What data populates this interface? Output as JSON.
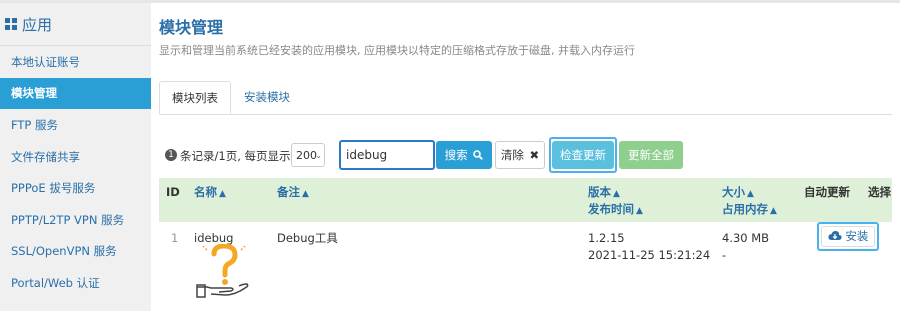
{
  "sidebar": {
    "header": "应用",
    "items": [
      {
        "label": "本地认证账号",
        "active": false
      },
      {
        "label": "模块管理",
        "active": true
      },
      {
        "label": "FTP 服务",
        "active": false
      },
      {
        "label": "文件存储共享",
        "active": false
      },
      {
        "label": "PPPoE 拔号服务",
        "active": false
      },
      {
        "label": "PPTP/L2TP VPN 服务",
        "active": false
      },
      {
        "label": "SSL/OpenVPN 服务",
        "active": false
      },
      {
        "label": "Portal/Web 认证",
        "active": false
      }
    ]
  },
  "main": {
    "title": "模块管理",
    "description": "显示和管理当前系统已经安装的应用模块, 应用模块以特定的压缩格式存放于磁盘, 并载入内存运行",
    "tabs": [
      {
        "label": "模块列表",
        "active": true
      },
      {
        "label": "安装模块",
        "active": false
      }
    ]
  },
  "toolbar": {
    "count_badge": "1",
    "pager_text": "条记录/1页, 每页显示",
    "page_size": "200",
    "search_value": "idebug",
    "search_label": "搜索",
    "clear_label": "清除",
    "check_update_label": "检查更新",
    "update_all_label": "更新全部"
  },
  "table": {
    "headers": {
      "id": "ID",
      "name": "名称",
      "note": "备注",
      "version": "版本",
      "publish_time": "发布时间",
      "size": "大小",
      "memory": "占用内存",
      "auto_update": "自动更新",
      "select": "选择"
    },
    "rows": [
      {
        "id": "1",
        "name": "idebug",
        "note": "Debug工具",
        "version": "1.2.15",
        "publish_time": "2021-11-25 15:21:24",
        "size": "4.30 MB",
        "memory": "-",
        "install_label": "安装"
      }
    ]
  },
  "colors": {
    "accent": "#2a9fd6",
    "link": "#2a6fa8",
    "table_header_bg": "#dff0d8",
    "highlight_border": "#4ab0f0"
  }
}
